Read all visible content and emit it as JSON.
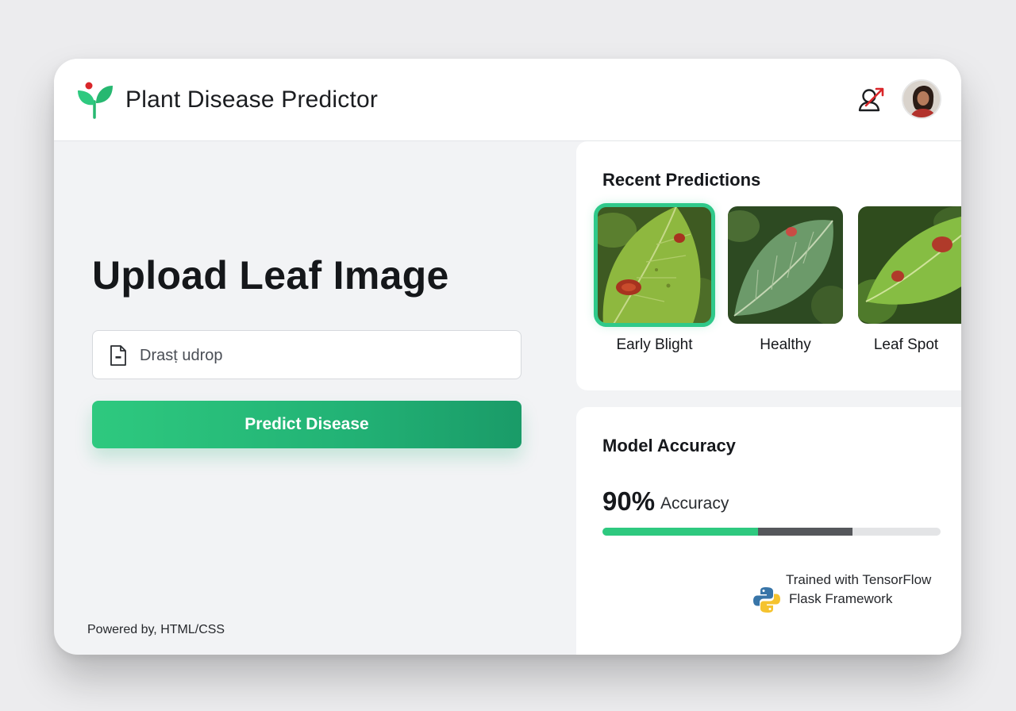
{
  "header": {
    "title": "Plant Disease Predictor",
    "logo_icon": "sprout-icon",
    "action_icon": "user-share-icon",
    "avatar": "user-avatar"
  },
  "upload": {
    "title": "Upload Leaf Image",
    "input_placeholder": "Drasṭ udrop",
    "input_icon": "file-icon",
    "predict_label": "Predict Disease"
  },
  "footer": {
    "powered_by": "Powered by, HTML/CSS"
  },
  "recent": {
    "title": "Recent Predictions",
    "items": [
      {
        "label": "Early Blight",
        "selected": true
      },
      {
        "label": "Healthy",
        "selected": false
      },
      {
        "label": "Leaf Spot",
        "selected": false
      }
    ]
  },
  "accuracy": {
    "title": "Model Accuracy",
    "value": "90%",
    "label": "Accuracy",
    "bar_green_fraction": 0.46,
    "bar_dark_fraction": 0.28,
    "trained_line1": "Trained with TensorFlow",
    "trained_line2": "Flask Framework",
    "framework_icon": "python-icon"
  },
  "colors": {
    "accent": "#2ec97f",
    "accent_dark": "#1a9b68",
    "brand_red": "#d9262a"
  }
}
